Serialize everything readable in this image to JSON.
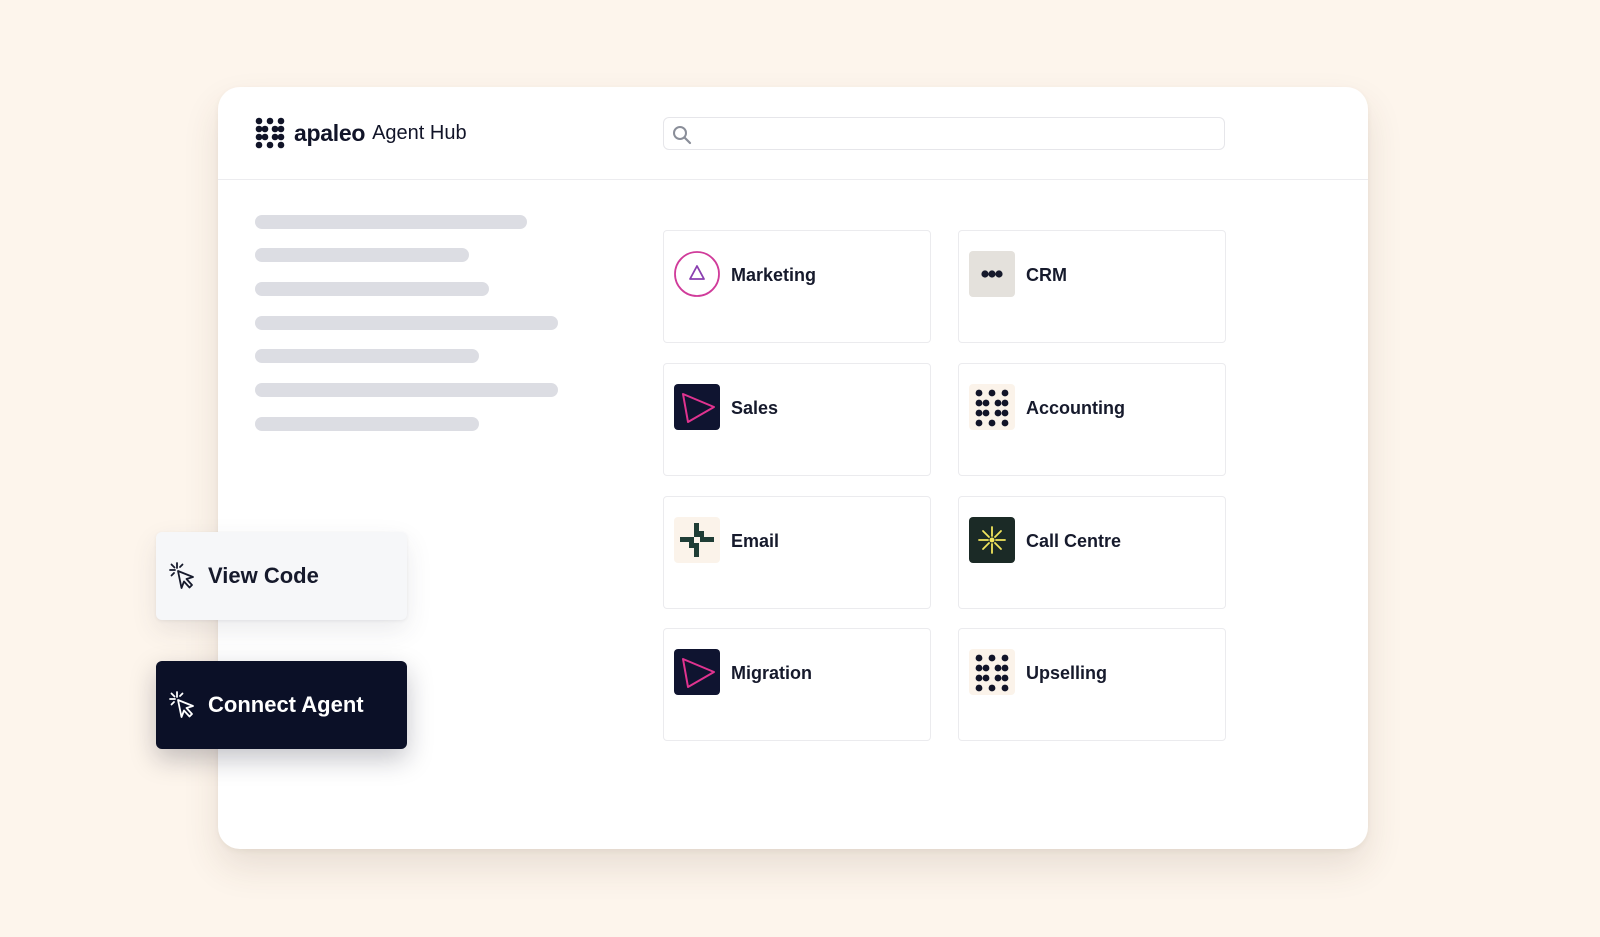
{
  "app": {
    "brand": "apaleo",
    "product": "Agent Hub"
  },
  "search": {
    "value": "",
    "placeholder": ""
  },
  "agents": [
    {
      "label": "Marketing",
      "icon": "marketing-triangle-icon"
    },
    {
      "label": "CRM",
      "icon": "crm-dots-icon"
    },
    {
      "label": "Sales",
      "icon": "sales-arrow-icon"
    },
    {
      "label": "Accounting",
      "icon": "accounting-dots-icon"
    },
    {
      "label": "Email",
      "icon": "email-cross-icon"
    },
    {
      "label": "Call Centre",
      "icon": "call-centre-burst-icon"
    },
    {
      "label": "Migration",
      "icon": "migration-arrow-icon"
    },
    {
      "label": "Upselling",
      "icon": "upselling-dots-icon"
    }
  ],
  "actions": {
    "view_code": "View Code",
    "connect_agent": "Connect Agent"
  },
  "colors": {
    "background": "#fdf5ec",
    "dark": "#0b1027",
    "accent_pink": "#e0338f",
    "accent_yellow": "#f2e65c",
    "skeleton": "#dcdde3"
  }
}
